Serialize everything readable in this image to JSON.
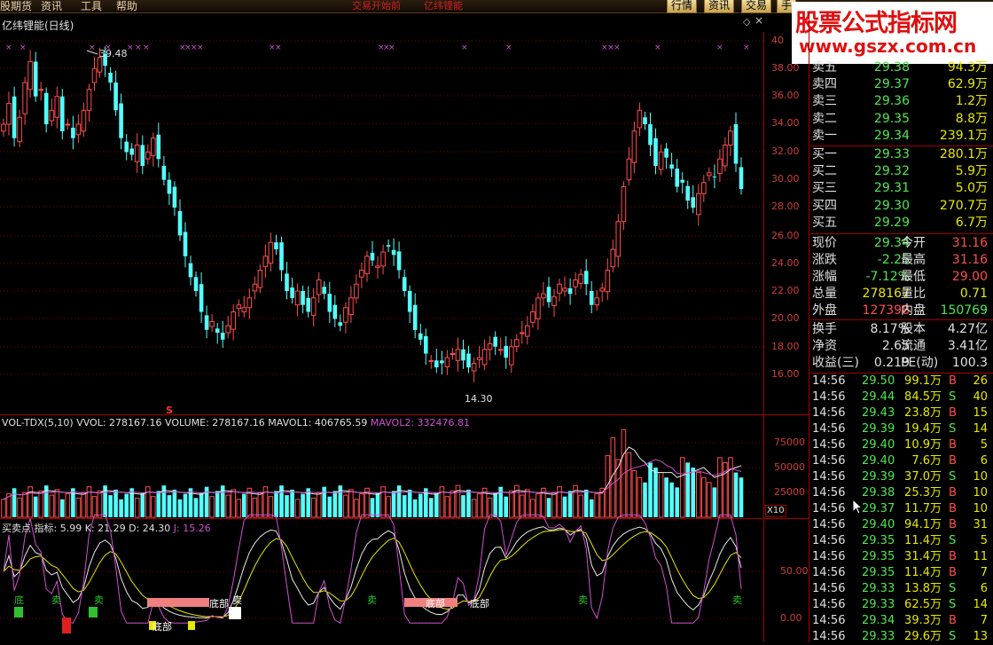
{
  "menu": {
    "items": [
      "股期货",
      "资讯",
      "工具",
      "帮助"
    ],
    "center_items": [
      "交易开始前",
      "亿纬锂能"
    ],
    "right_tabs": [
      "行情",
      "资讯",
      "交易",
      "手"
    ]
  },
  "watermark": {
    "line1": "股票公式指标网",
    "line2": "www.gszx.com.cn"
  },
  "stock": {
    "title": "亿纬锂能(日线)"
  },
  "price_chart": {
    "y_labels": [
      "40",
      "38.00",
      "36.00",
      "34.00",
      "32.00",
      "30.00",
      "28.00",
      "26.00",
      "24.00",
      "22.00",
      "20.00",
      "18.00",
      "16.00"
    ],
    "high_label": "39.48",
    "low_label": "14.30",
    "signal_text": "S"
  },
  "volume_chart": {
    "legend": {
      "title": "VOL-TDX(5,10)",
      "vvol": "VVOL: 278167.16",
      "volume": "VOLUME: 278167.16",
      "mavol1": "MAVOL1: 406765.59",
      "mavol2": "MAVOL2: 332476.81"
    },
    "y_labels": [
      "75000",
      "50000",
      "25000"
    ],
    "unit": "X10"
  },
  "kdj_chart": {
    "legend": {
      "title": "买卖点",
      "indicator": "指标: 5.99",
      "k": "K: 21.29",
      "d": "D: 24.30",
      "j": "J: 15.26"
    },
    "y_labels": [
      "50.00",
      "0.00"
    ],
    "tags": [
      "底",
      "卖",
      "卖",
      "底部",
      "底部",
      "卖",
      "底部",
      "底部",
      "卖",
      "卖",
      "卖"
    ]
  },
  "order_book": {
    "sell": [
      {
        "label": "卖五",
        "price": "29.38",
        "vol": "94.3万"
      },
      {
        "label": "卖四",
        "price": "29.37",
        "vol": "62.9万"
      },
      {
        "label": "卖三",
        "price": "29.36",
        "vol": "1.2万"
      },
      {
        "label": "卖二",
        "price": "29.35",
        "vol": "8.8万"
      },
      {
        "label": "卖一",
        "price": "29.34",
        "vol": "239.1万"
      }
    ],
    "buy": [
      {
        "label": "买一",
        "price": "29.33",
        "vol": "280.1万"
      },
      {
        "label": "买二",
        "price": "29.32",
        "vol": "5.9万"
      },
      {
        "label": "买三",
        "price": "29.31",
        "vol": "5.0万"
      },
      {
        "label": "买四",
        "price": "29.30",
        "vol": "270.7万"
      },
      {
        "label": "买五",
        "price": "29.29",
        "vol": "6.7万"
      }
    ]
  },
  "stats": {
    "xianjia": {
      "label": "现价",
      "value": "29.34",
      "label2": "今开",
      "value2": "31.16"
    },
    "zhangdie": {
      "label": "涨跌",
      "value": "-2.25",
      "label2": "最高",
      "value2": "31.16"
    },
    "zhangfu": {
      "label": "涨幅",
      "value": "-7.12%",
      "label2": "最低",
      "value2": "29.00"
    },
    "zongliang": {
      "label": "总量",
      "value": "278167",
      "label2": "量比",
      "value2": "0.71"
    },
    "waipan": {
      "label": "外盘",
      "value": "127398",
      "label2": "内盘",
      "value2": "150769"
    },
    "huanshou": {
      "label": "换手",
      "value": "8.17%",
      "label2": "股本",
      "value2": "4.27亿"
    },
    "jingzi": {
      "label": "净资",
      "value": "2.65",
      "label2": "流通",
      "value2": "3.41亿"
    },
    "shouyi": {
      "label": "收益(三)",
      "value": "0.219",
      "label2": "PE(动)",
      "value2": "100.3"
    }
  },
  "ticks": [
    {
      "time": "14:56",
      "price": "29.50",
      "vol": "99.1万",
      "bs": "B",
      "n": "26"
    },
    {
      "time": "14:56",
      "price": "29.44",
      "vol": "84.5万",
      "bs": "S",
      "n": "40"
    },
    {
      "time": "14:56",
      "price": "29.43",
      "vol": "23.8万",
      "bs": "B",
      "n": "15"
    },
    {
      "time": "14:56",
      "price": "29.39",
      "vol": "19.4万",
      "bs": "S",
      "n": "14"
    },
    {
      "time": "14:56",
      "price": "29.40",
      "vol": "10.9万",
      "bs": "B",
      "n": "5"
    },
    {
      "time": "14:56",
      "price": "29.40",
      "vol": "7.6万",
      "bs": "B",
      "n": "6"
    },
    {
      "time": "14:56",
      "price": "29.39",
      "vol": "37.0万",
      "bs": "S",
      "n": "10"
    },
    {
      "time": "14:56",
      "price": "29.38",
      "vol": "25.3万",
      "bs": "B",
      "n": "10"
    },
    {
      "time": "14:56",
      "price": "29.37",
      "vol": "11.7万",
      "bs": "B",
      "n": "10"
    },
    {
      "time": "14:56",
      "price": "29.40",
      "vol": "94.1万",
      "bs": "B",
      "n": "31"
    },
    {
      "time": "14:56",
      "price": "29.35",
      "vol": "11.4万",
      "bs": "S",
      "n": "5"
    },
    {
      "time": "14:56",
      "price": "29.35",
      "vol": "31.4万",
      "bs": "B",
      "n": "11"
    },
    {
      "time": "14:56",
      "price": "29.35",
      "vol": "11.4万",
      "bs": "B",
      "n": "7"
    },
    {
      "time": "14:56",
      "price": "29.33",
      "vol": "13.8万",
      "bs": "S",
      "n": "6"
    },
    {
      "time": "14:56",
      "price": "29.33",
      "vol": "62.5万",
      "bs": "S",
      "n": "14"
    },
    {
      "time": "14:56",
      "price": "29.34",
      "vol": "39.3万",
      "bs": "B",
      "n": "7"
    },
    {
      "time": "14:56",
      "price": "29.33",
      "vol": "29.6万",
      "bs": "S",
      "n": "13"
    }
  ],
  "colors": {
    "up": "#ff4d4d",
    "down": "#54ffff",
    "grid": "#a00000",
    "accent_purple": "#d050d0"
  },
  "icons": [
    "diamond-icon",
    "close-icon",
    "cursor-arrow-icon"
  ]
}
